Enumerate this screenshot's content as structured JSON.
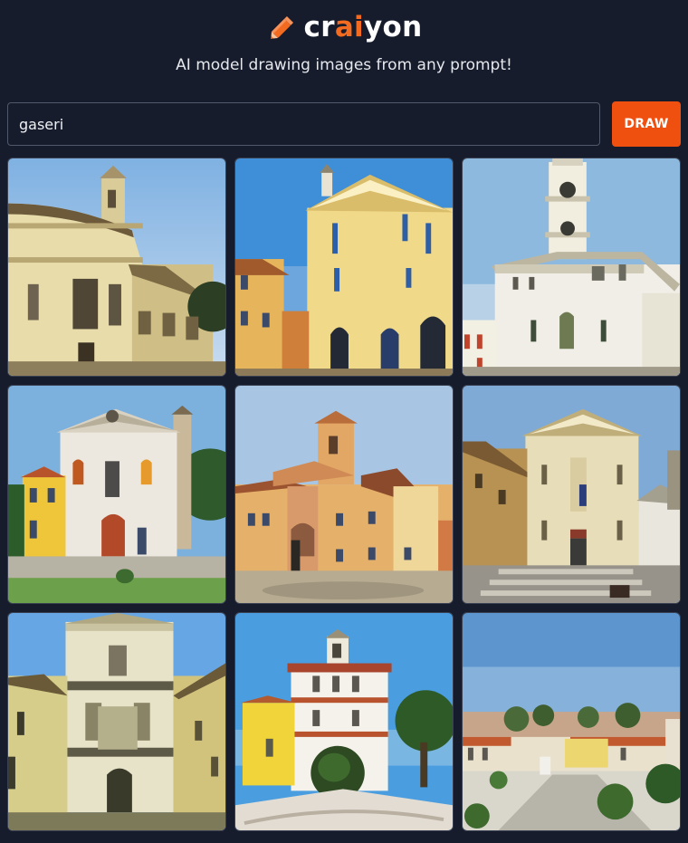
{
  "header": {
    "logo": {
      "part1": "cr",
      "accent": "ai",
      "part2": "yon",
      "icon": "pencil-icon"
    },
    "tagline": "AI model drawing images from any prompt!"
  },
  "search": {
    "value": "gaseri",
    "placeholder": ""
  },
  "draw_button": {
    "label": "DRAW"
  },
  "colors": {
    "background": "#161c2b",
    "accent": "#f0500f",
    "input_border": "#50586a"
  },
  "gallery": {
    "count": 9
  }
}
